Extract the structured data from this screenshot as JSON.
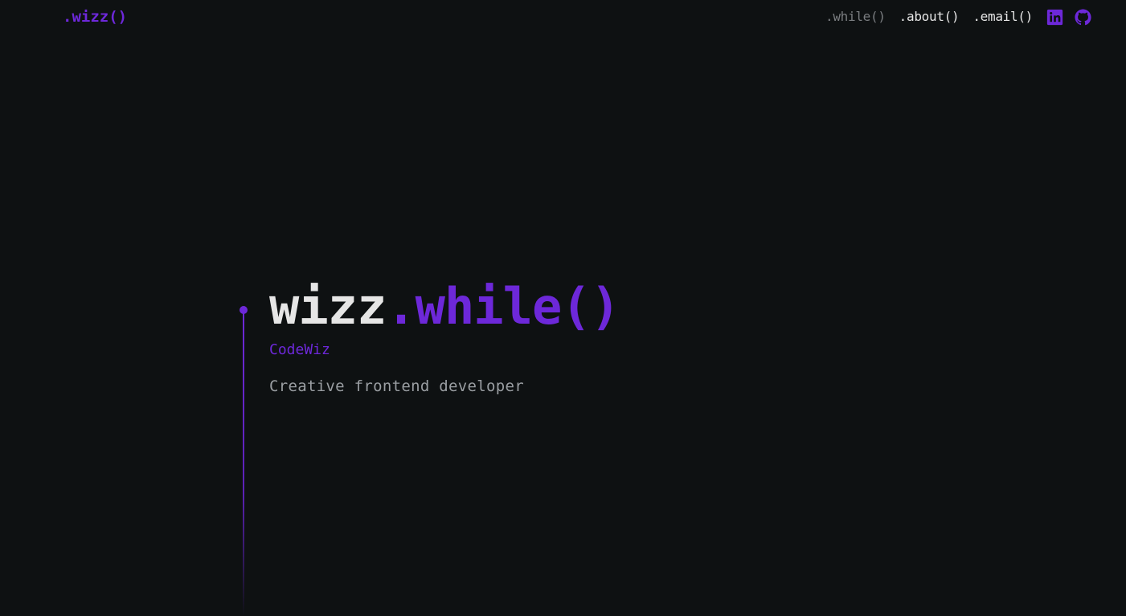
{
  "header": {
    "logo": ".wizz()",
    "nav": [
      {
        "label": ".while()",
        "active": true
      },
      {
        "label": ".about()",
        "active": false
      },
      {
        "label": ".email()",
        "active": false
      }
    ],
    "social": [
      {
        "icon": "linkedin-icon"
      },
      {
        "icon": "github-icon"
      }
    ]
  },
  "hero": {
    "title_part1": "wizz",
    "title_part2": ".while()",
    "subtitle": "CodeWiz",
    "description": "Creative frontend developer"
  },
  "colors": {
    "background": "#0e1112",
    "accent": "#6d28d9",
    "text": "#e6e6e6",
    "muted": "#9a9ea2"
  }
}
